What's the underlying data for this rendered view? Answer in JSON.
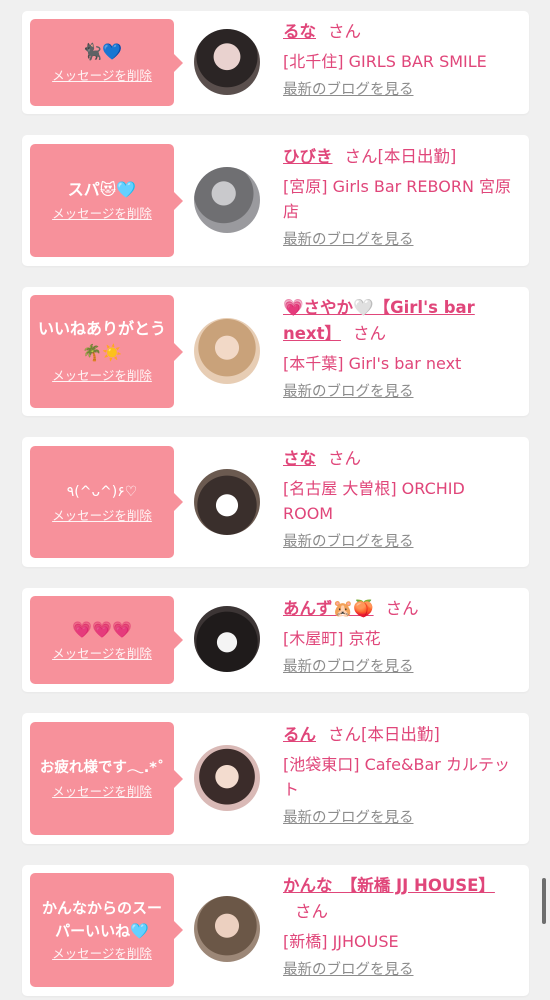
{
  "delete_label": "メッセージを削除",
  "blog_label": "最新のブログを見る",
  "san_label": "さん",
  "cards": [
    {
      "message": "🐈‍⬛💙",
      "name": "るな",
      "attend": "",
      "shop": "[北千住] GIRLS BAR SMILE"
    },
    {
      "message": "スパ😻🩵",
      "name": "ひびき",
      "attend": "[本日出勤]",
      "shop": "[宮原] Girls Bar REBORN 宮原店"
    },
    {
      "message": "いいねありがとう🌴☀️",
      "name": "💗さやか🤍【Girl's bar next】",
      "attend": "",
      "shop": "[本千葉] Girl's bar next"
    },
    {
      "message": "٩(^ᴗ^)۶♡",
      "name": "さな",
      "attend": "",
      "shop": "[名古屋 大曽根] ORCHID ROOM"
    },
    {
      "message": "💗💗💗",
      "name": "あんず🐹🍑",
      "attend": "",
      "shop": "[木屋町] 京花"
    },
    {
      "message": "お疲れ様です𓂃.*˚",
      "name": "るん",
      "attend": "[本日出勤]",
      "shop": "[池袋東口] Cafe&Bar カルテット"
    },
    {
      "message": "かんなからのスーパーいいね🩵",
      "name": "かんな　【新橋 JJ HOUSE】",
      "attend": "",
      "shop": "[新橋] JJHOUSE"
    }
  ]
}
